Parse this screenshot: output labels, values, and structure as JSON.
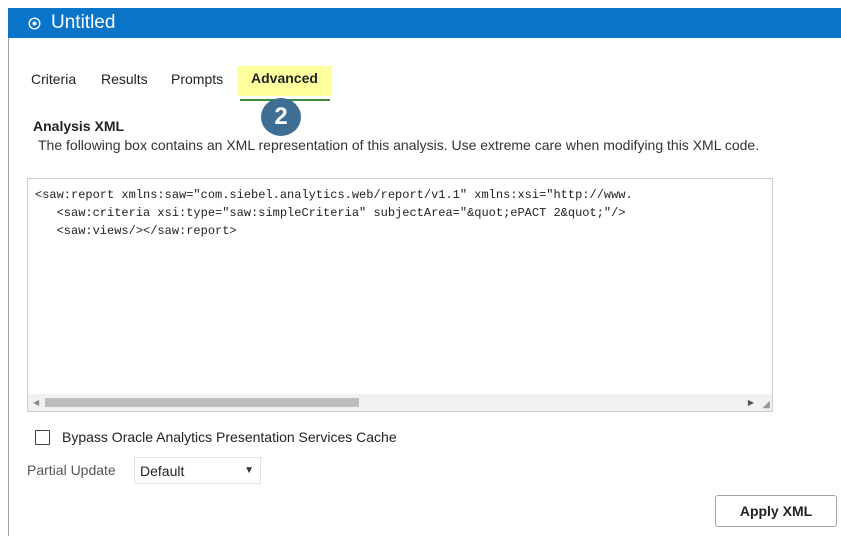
{
  "window": {
    "title": "Untitled"
  },
  "tabs": [
    {
      "label": "Criteria"
    },
    {
      "label": "Results"
    },
    {
      "label": "Prompts"
    },
    {
      "label": "Advanced",
      "active": true
    }
  ],
  "step_badge": "2",
  "section": {
    "title": "Analysis XML",
    "description": "The following box contains an XML representation of this analysis. Use extreme care when modifying this XML code."
  },
  "xml_editor": {
    "lines": [
      "<saw:report xmlns:saw=\"com.siebel.analytics.web/report/v1.1\" xmlns:xsi=\"http://www.",
      "   <saw:criteria xsi:type=\"saw:simpleCriteria\" subjectArea=\"&quot;ePACT 2&quot;\"/>",
      "   <saw:views/></saw:report>"
    ]
  },
  "cache_checkbox": {
    "label": "Bypass Oracle Analytics Presentation Services Cache",
    "checked": false
  },
  "partial_update": {
    "label": "Partial Update",
    "value": "Default"
  },
  "apply_button": {
    "label": "Apply XML"
  },
  "colors": {
    "titlebar": "#0a74c9",
    "active_tab_highlight": "#ffff9e",
    "badge": "#3f6e95"
  },
  "icons": {
    "title": "target-icon",
    "dropdown": "caret-down-icon"
  }
}
